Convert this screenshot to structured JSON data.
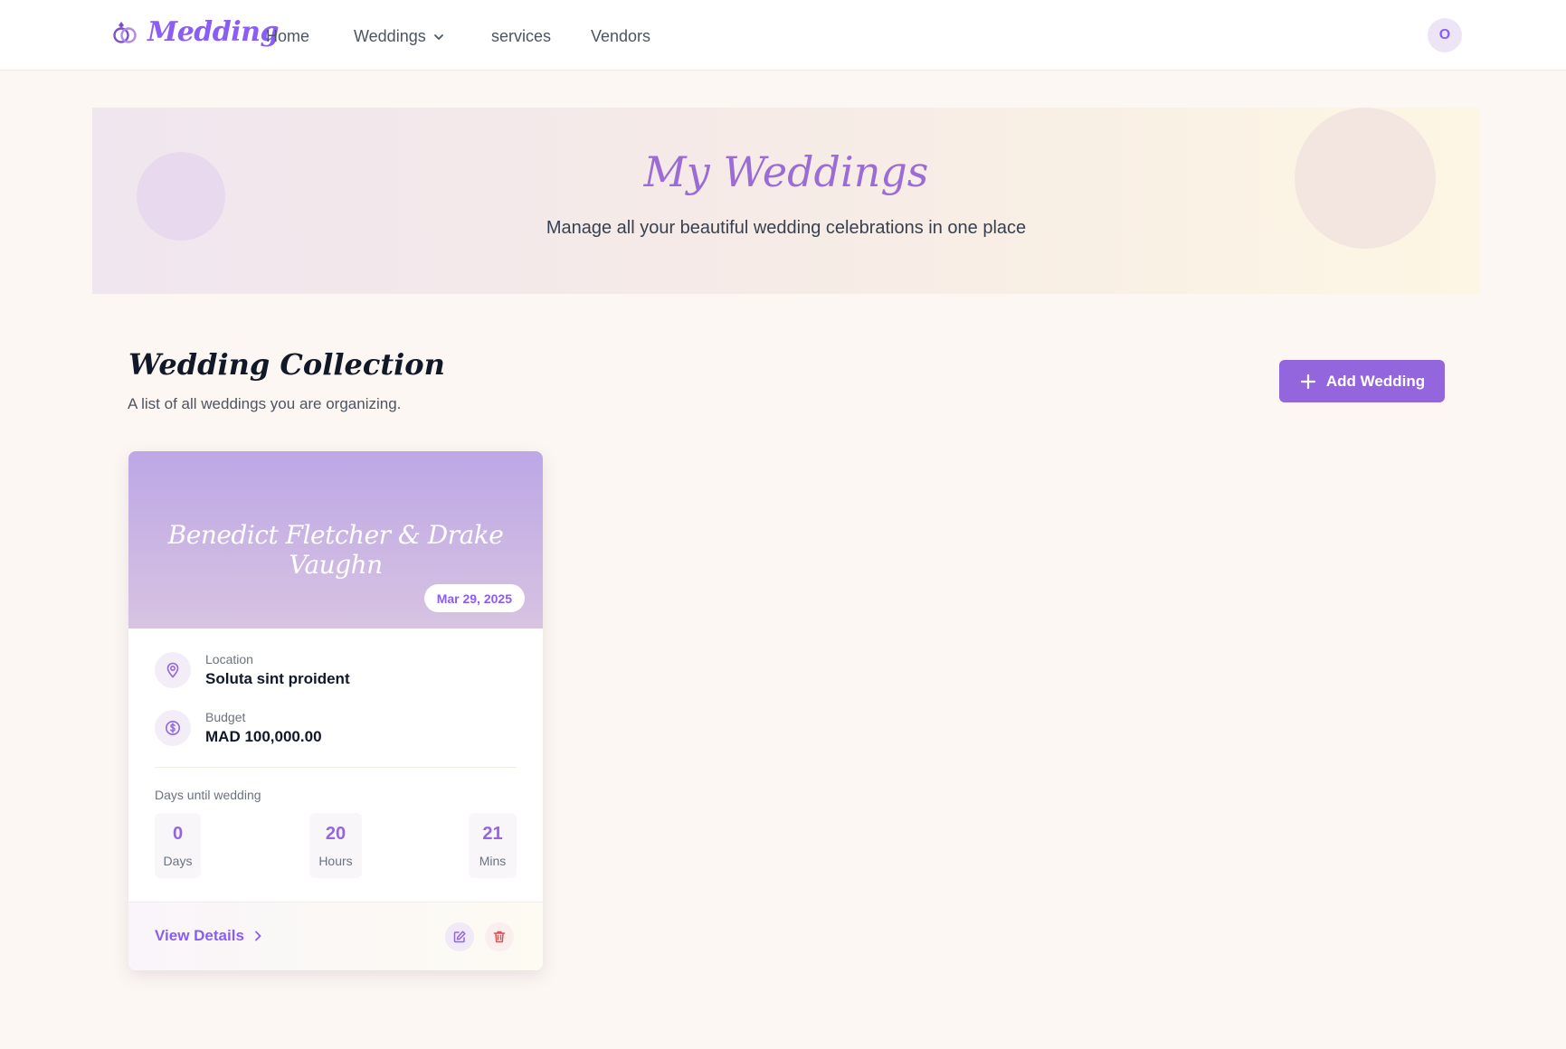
{
  "nav": {
    "brand": "Medding",
    "links": {
      "home": "Home",
      "weddings": "Weddings",
      "services": "services",
      "vendors": "Vendors"
    },
    "avatar_initial": "O"
  },
  "hero": {
    "title": "My Weddings",
    "subtitle": "Manage all your beautiful wedding celebrations in one place"
  },
  "section": {
    "title": "Wedding Collection",
    "subtitle": "A list of all weddings you are organizing.",
    "add_button": "Add Wedding"
  },
  "wedding_card": {
    "couple": "Benedict Fletcher & Drake Vaughn",
    "date": "Mar 29, 2025",
    "location_label": "Location",
    "location_value": "Soluta sint proident",
    "budget_label": "Budget",
    "budget_value": "MAD 100,000.00",
    "countdown_label": "Days until wedding",
    "countdown": {
      "days": "0",
      "days_unit": "Days",
      "hours": "20",
      "hours_unit": "Hours",
      "mins": "21",
      "mins_unit": "Mins"
    },
    "view_details": "View Details"
  },
  "colors": {
    "accent": "#9466de",
    "background": "#fcf7f3",
    "delete": "#e05252"
  },
  "icons": [
    "rings-icon",
    "chevron-down-icon",
    "plus-icon",
    "location-pin-icon",
    "dollar-icon",
    "chevron-right-icon",
    "edit-icon",
    "trash-icon"
  ]
}
